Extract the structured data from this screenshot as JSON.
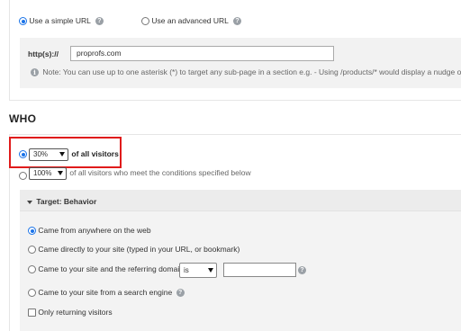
{
  "url_section": {
    "simple_url_label": "Use a simple URL",
    "advanced_url_label": "Use an advanced URL",
    "protocol_label": "http(s)://",
    "url_value": "proprofs.com",
    "note": "Note: You can use up to one asterisk (*) to target any sub-page in a section e.g. - Using /products/* would display a nudge on all th",
    "help_glyph": "?",
    "info_glyph": "i"
  },
  "who": {
    "heading": "WHO",
    "percent_select_1": "30%",
    "of_all_visitors_bold": "of all visitors",
    "percent_select_2": "100%",
    "conditions_text": "of all visitors who meet the conditions specified below"
  },
  "behavior": {
    "header": "Target: Behavior",
    "options": {
      "anywhere": "Came from anywhere on the web",
      "directly": "Came directly to your site (typed in your URL, or bookmark)",
      "referring": "Came to your site and the referring domain",
      "referring_operator": "is",
      "search_engine": "Came to your site from a search engine",
      "returning": "Only returning visitors"
    }
  },
  "colors": {
    "accent": "#1a73e8",
    "highlight": "#e01b1b"
  }
}
